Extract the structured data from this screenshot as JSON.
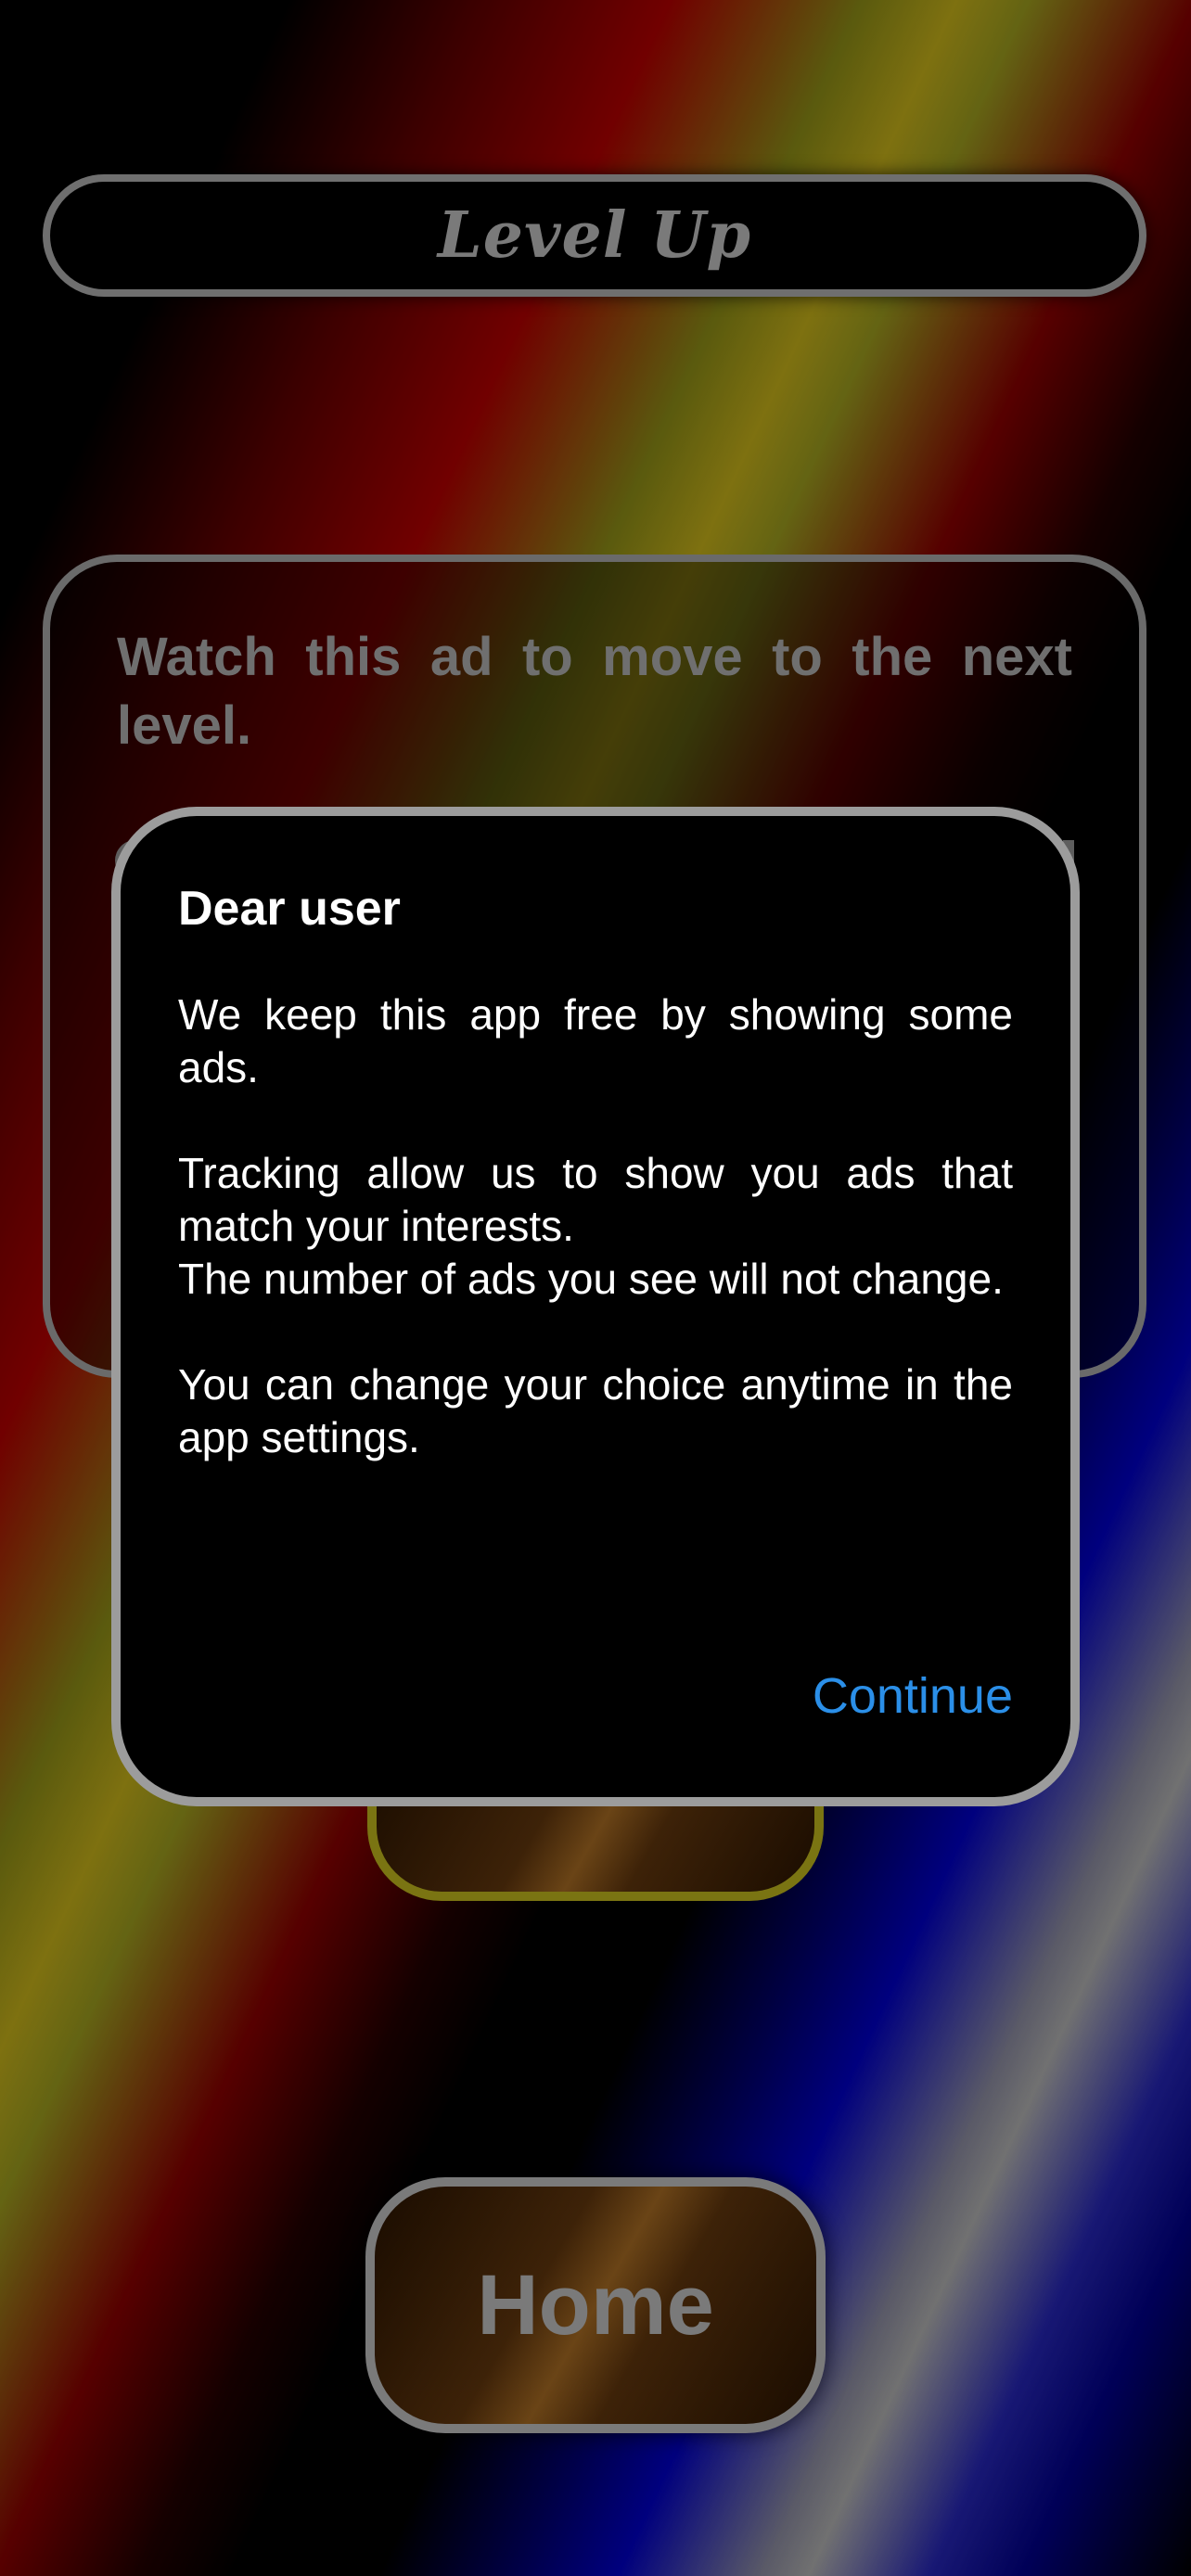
{
  "header": {
    "title": "Level Up"
  },
  "info_card": {
    "text": "Watch this ad to move to the next level."
  },
  "dialog": {
    "title": "Dear user",
    "paragraph_1": "We keep this app free by showing some ads.",
    "paragraph_2": "Tracking allow us to show you ads that match your interests.",
    "paragraph_3": "The number of ads you see will not change.",
    "paragraph_4": "You can change your choice anytime in the app settings.",
    "continue_label": "Continue",
    "accent_color": "#2b8fe8"
  },
  "home_button": {
    "label": "Home"
  }
}
